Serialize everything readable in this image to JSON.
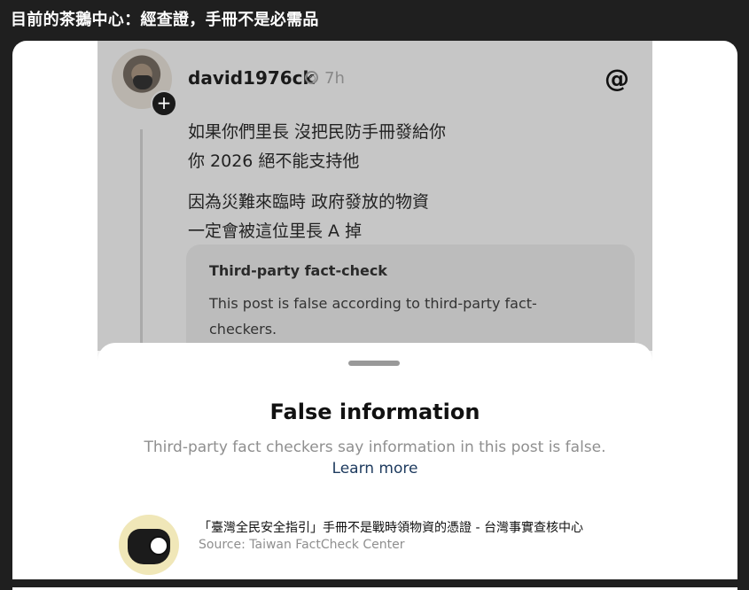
{
  "caption": "目前的茶鵝中心：經查證，手冊不是必需品",
  "post": {
    "username": "david1976ck",
    "time": "7h",
    "lines": [
      "如果你們里長 沒把民防手冊發給你",
      "你 2026 絕不能支持他",
      "因為災難來臨時 政府發放的物資",
      "一定會被這位里長 A 掉"
    ]
  },
  "fact_check": {
    "title": "Third-party fact-check",
    "body": "This post is false according to third-party fact-checkers."
  },
  "sheet": {
    "title": "False information",
    "subtitle": "Third-party fact checkers say information in this post is false.",
    "link": "Learn more",
    "source_title": "「臺灣全民安全指引」手冊不是戰時領物資的憑證 - 台灣事實查核中心",
    "source_name": "Source: Taiwan FactCheck Center"
  },
  "icons": {
    "plus": "+",
    "threads": "@"
  }
}
